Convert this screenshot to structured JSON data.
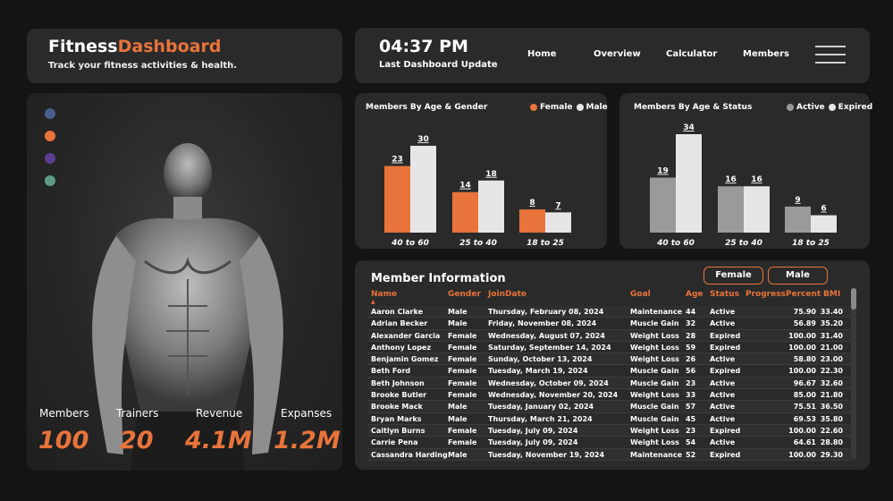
{
  "header": {
    "title_part1": "Fitness",
    "title_part2": "Dashboard",
    "subtitle": "Track your fitness activities & health.",
    "time": "04:37 PM",
    "time_label": "Last Dashboard Update",
    "nav": [
      "Home",
      "Overview",
      "Calculator",
      "Members"
    ]
  },
  "theme": {
    "accent": "#e8743b",
    "grey": "#9a9a9a",
    "light": "#e6e6e6",
    "card": "#2a2a2a"
  },
  "hero": {
    "dots": [
      "#4a5e8c",
      "#e8743b",
      "#5b3d8f",
      "#5f9a86"
    ],
    "kpis": [
      {
        "label": "Members",
        "value": "100"
      },
      {
        "label": "Trainers",
        "value": "20"
      },
      {
        "label": "Revenue",
        "value": "4.1M"
      },
      {
        "label": "Expanses",
        "value": "1.2M"
      }
    ]
  },
  "chart_data": [
    {
      "type": "bar",
      "title": "Members By Age & Gender",
      "categories": [
        "40 to 60",
        "25 to 40",
        "18 to 25"
      ],
      "series": [
        {
          "name": "Female",
          "color": "#e8743b",
          "values": [
            23,
            14,
            8
          ]
        },
        {
          "name": "Male",
          "color": "#e6e6e6",
          "values": [
            30,
            18,
            7
          ]
        }
      ],
      "ylim": [
        0,
        34
      ]
    },
    {
      "type": "bar",
      "title": "Members By Age & Status",
      "categories": [
        "40 to 60",
        "25 to 40",
        "18 to 25"
      ],
      "series": [
        {
          "name": "Active",
          "color": "#9a9a9a",
          "values": [
            19,
            16,
            9
          ]
        },
        {
          "name": "Expired",
          "color": "#e6e6e6",
          "values": [
            34,
            16,
            6
          ]
        }
      ],
      "ylim": [
        0,
        34
      ]
    }
  ],
  "table": {
    "title": "Member Information",
    "filters": [
      "Female",
      "Male"
    ],
    "columns": [
      "Name",
      "Gender",
      "JoinDate",
      "Goal",
      "Age",
      "Status",
      "ProgressPercent",
      "BMI"
    ],
    "rows": [
      [
        "Aaron Clarke",
        "Male",
        "Thursday, February 08, 2024",
        "Maintenance",
        "44",
        "Active",
        "75.90",
        "33.40"
      ],
      [
        "Adrian Becker",
        "Male",
        "Friday, November 08, 2024",
        "Muscle Gain",
        "32",
        "Active",
        "56.89",
        "35.20"
      ],
      [
        "Alexander Garcia",
        "Female",
        "Wednesday, August 07, 2024",
        "Weight Loss",
        "28",
        "Expired",
        "100.00",
        "31.40"
      ],
      [
        "Anthony Lopez",
        "Female",
        "Saturday, September 14, 2024",
        "Weight Loss",
        "59",
        "Expired",
        "100.00",
        "21.00"
      ],
      [
        "Benjamin Gomez",
        "Female",
        "Sunday, October 13, 2024",
        "Weight Loss",
        "26",
        "Active",
        "58.80",
        "23.00"
      ],
      [
        "Beth Ford",
        "Female",
        "Tuesday, March 19, 2024",
        "Muscle Gain",
        "56",
        "Expired",
        "100.00",
        "22.30"
      ],
      [
        "Beth Johnson",
        "Female",
        "Wednesday, October 09, 2024",
        "Muscle Gain",
        "23",
        "Active",
        "96.67",
        "32.60"
      ],
      [
        "Brooke Butler",
        "Female",
        "Wednesday, November 20, 2024",
        "Weight Loss",
        "33",
        "Active",
        "85.00",
        "21.80"
      ],
      [
        "Brooke Mack",
        "Male",
        "Tuesday, January 02, 2024",
        "Muscle Gain",
        "57",
        "Active",
        "75.51",
        "36.50"
      ],
      [
        "Bryan Marks",
        "Male",
        "Thursday, March 21, 2024",
        "Muscle Gain",
        "45",
        "Active",
        "69.53",
        "35.80"
      ],
      [
        "Caitlyn Burns",
        "Female",
        "Tuesday, July 09, 2024",
        "Weight Loss",
        "23",
        "Expired",
        "100.00",
        "22.60"
      ],
      [
        "Carrie Pena",
        "Female",
        "Tuesday, July 09, 2024",
        "Weight Loss",
        "54",
        "Active",
        "64.61",
        "28.80"
      ],
      [
        "Cassandra Harding",
        "Male",
        "Tuesday, November 19, 2024",
        "Maintenance",
        "52",
        "Expired",
        "100.00",
        "29.30"
      ]
    ]
  }
}
